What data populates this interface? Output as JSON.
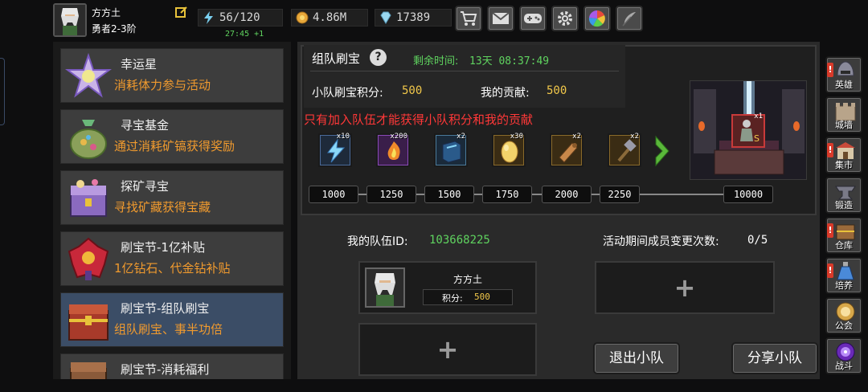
{
  "player": {
    "name": "方方土",
    "rank": "勇者2-3阶",
    "energy": "56/120",
    "energy_regen": "27:45 +1",
    "gold": "4.86M",
    "diamonds": "17389"
  },
  "topbar": {
    "buttons": [
      "cart-icon",
      "mail-icon",
      "gamepad-icon",
      "gear-icon",
      "color-wheel-icon",
      "feather-icon"
    ]
  },
  "activities": [
    {
      "title": "幸运星",
      "subtitle": "消耗体力参与活动"
    },
    {
      "title": "寻宝基金",
      "subtitle": "通过消耗矿镐获得奖励"
    },
    {
      "title": "探矿寻宝",
      "subtitle": "寻找矿藏获得宝藏"
    },
    {
      "title": "刷宝节-1亿补贴",
      "subtitle": "1亿钻石、代金钻补贴"
    },
    {
      "title": "刷宝节-组队刷宝",
      "subtitle": "组队刷宝、事半功倍"
    },
    {
      "title": "刷宝节-消耗福利",
      "subtitle": ""
    }
  ],
  "event": {
    "title": "组队刷宝",
    "help": "?",
    "remaining_label": "剩余时间:",
    "remaining_value": "13天 08:37:49",
    "team_score_label": "小队刷宝积分:",
    "team_score_value": "500",
    "my_contrib_label": "我的贡献:",
    "my_contrib_value": "500",
    "warning": "只有加入队伍才能获得小队积分和我的贡献",
    "rewards": [
      {
        "icon": "lightning-icon",
        "count": "x10"
      },
      {
        "icon": "fire-scroll-icon",
        "count": "x200"
      },
      {
        "icon": "spellbook-icon",
        "count": "x2"
      },
      {
        "icon": "egg-icon",
        "count": "x30"
      },
      {
        "icon": "scroll-icon",
        "count": "x2"
      },
      {
        "icon": "hammer-icon",
        "count": "x2"
      }
    ],
    "milestones": [
      "1000",
      "1250",
      "1500",
      "1750",
      "2000",
      "2250",
      "10000"
    ],
    "chest_reward_count": "x1"
  },
  "team": {
    "id_label": "我的队伍ID:",
    "id_value": "103668225",
    "changes_label": "活动期间成员变更次数:",
    "changes_value": "0/5",
    "member": {
      "name": "方方土",
      "score_label": "积分:",
      "score_value": "500"
    },
    "add_symbol": "+",
    "leave_button": "退出小队",
    "share_button": "分享小队"
  },
  "sidebar": [
    {
      "label": "英雄",
      "icon": "hero-helmet-icon",
      "alert": true
    },
    {
      "label": "城墙",
      "icon": "wall-icon",
      "alert": false
    },
    {
      "label": "集市",
      "icon": "market-icon",
      "alert": true
    },
    {
      "label": "锻造",
      "icon": "anvil-icon",
      "alert": false
    },
    {
      "label": "仓库",
      "icon": "warehouse-icon",
      "alert": true
    },
    {
      "label": "培养",
      "icon": "potion-icon",
      "alert": true
    },
    {
      "label": "公会",
      "icon": "guild-icon",
      "alert": false
    },
    {
      "label": "战斗",
      "icon": "portal-icon",
      "alert": false
    }
  ],
  "colors": {
    "green_text": "#5fd35f",
    "gold_text": "#f2c84a",
    "orange_text": "#f09a2e",
    "warning_red": "#ff3838",
    "selected_item": "#3b4d66"
  }
}
